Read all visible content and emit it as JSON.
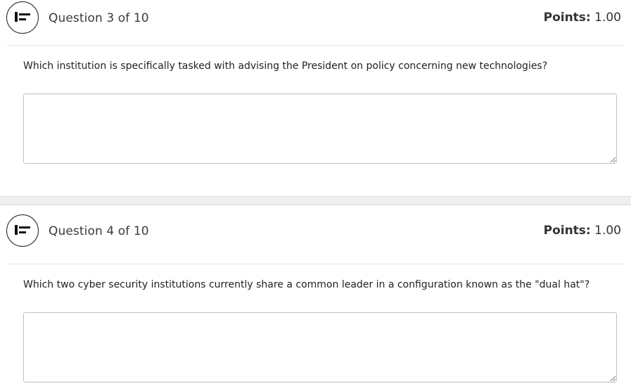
{
  "questions": [
    {
      "title": "Question 3 of 10",
      "points_label": "Points:",
      "points_value": "1.00",
      "prompt": "Which institution is specifically tasked with advising the President on policy concerning new technologies?",
      "answer": "",
      "icon": "flag-toggle-icon"
    },
    {
      "title": "Question 4 of 10",
      "points_label": "Points:",
      "points_value": "1.00",
      "prompt": "Which two cyber security institutions currently share a common leader in a configuration known as the \"dual hat\"?",
      "answer": "",
      "icon": "flag-toggle-icon"
    }
  ]
}
